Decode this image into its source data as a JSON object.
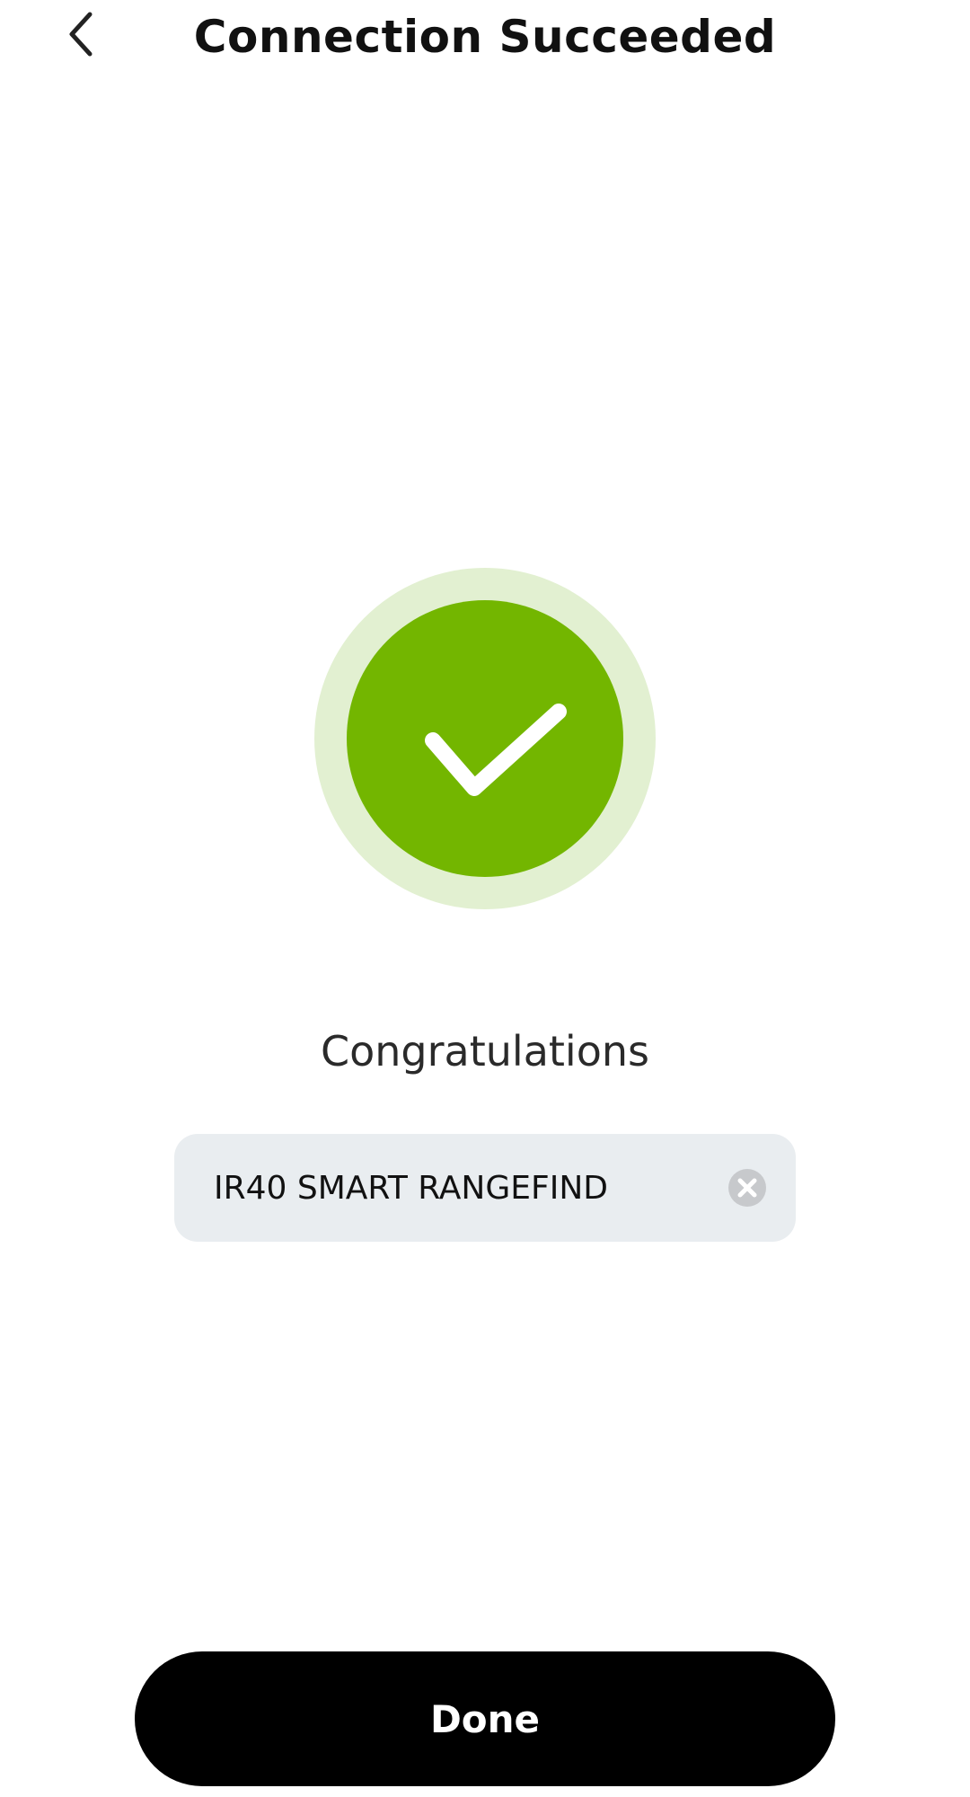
{
  "header": {
    "title": "Connection Succeeded",
    "back_icon": "chevron-left-icon"
  },
  "status": {
    "icon": "check-circle-icon",
    "message": "Congratulations",
    "colors": {
      "circle": "#73b600",
      "halo": "#e2f0d1",
      "check": "#ffffff"
    }
  },
  "device_name_field": {
    "value": "IR40 SMART RANGEFIND",
    "clear_icon": "clear-icon",
    "background": "#e9edf0"
  },
  "footer": {
    "done_label": "Done"
  }
}
